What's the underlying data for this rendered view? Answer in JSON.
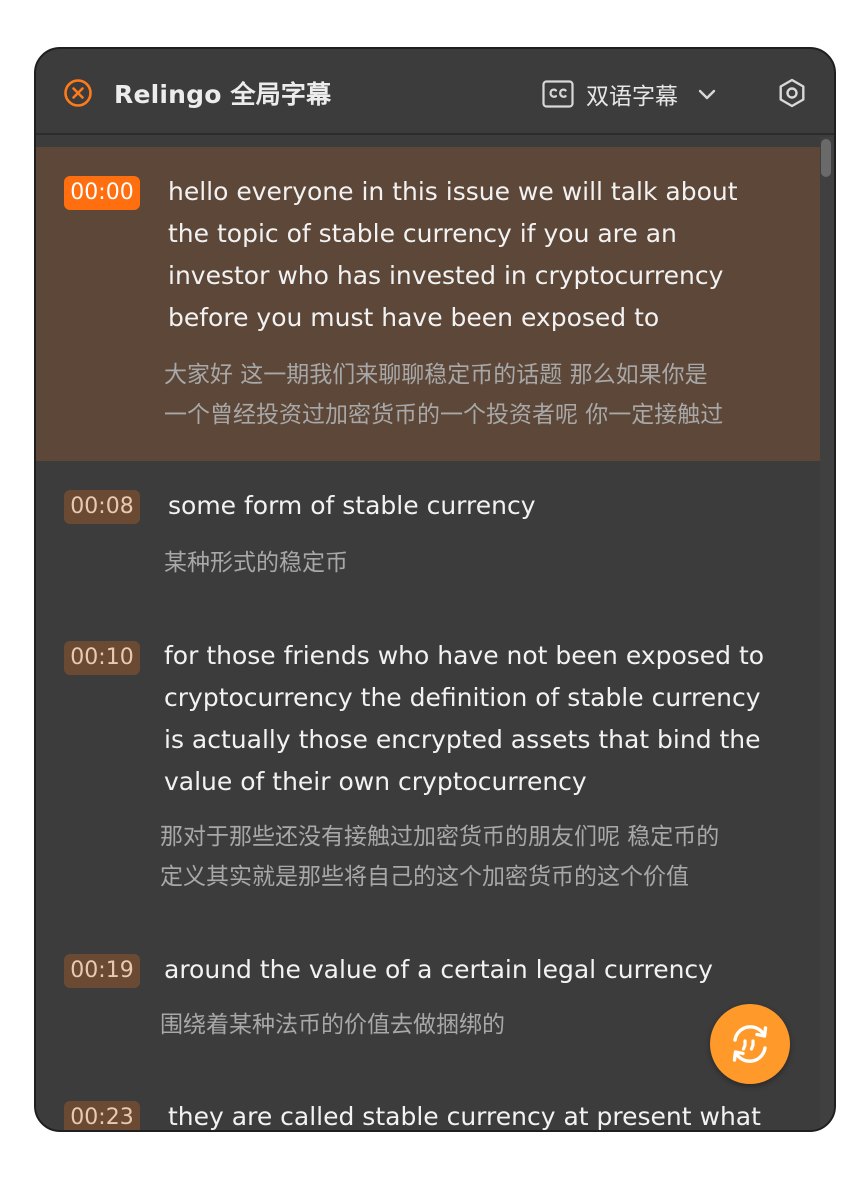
{
  "header": {
    "title": "Relingo 全局字幕",
    "mode_label": "双语字幕",
    "close_icon": "close-circle-icon",
    "cc_icon": "cc-icon",
    "settings_icon": "hexagon-gear-icon",
    "accent": "#ff7a1a"
  },
  "subtitles": [
    {
      "time": "00:00",
      "active": true,
      "en_lines": [
        "hello everyone in this issue we will talk about",
        "the topic of stable currency if you are an",
        "investor who has invested in cryptocurrency",
        "before you must have been exposed to"
      ],
      "zh_lines": [
        "大家好 这一期我们来聊聊稳定币的话题 那么如果你是",
        "一个曾经投资过加密货币的一个投资者呢 你一定接触过"
      ]
    },
    {
      "time": "00:08",
      "active": false,
      "en_lines": [
        "some form of stable currency"
      ],
      "zh_lines": [
        "某种形式的稳定币"
      ]
    },
    {
      "time": "00:10",
      "active": false,
      "en_lines": [
        "for those friends who have not been exposed to",
        "cryptocurrency the definition of stable currency",
        "is actually those encrypted assets that bind the",
        "value of their own cryptocurrency"
      ],
      "zh_lines": [
        "那对于那些还没有接触过加密货币的朋友们呢 稳定币的",
        "定义其实就是那些将自己的这个加密货币的这个价值"
      ]
    },
    {
      "time": "00:19",
      "active": false,
      "en_lines": [
        "around the value of a certain legal currency"
      ],
      "zh_lines": [
        "围绕着某种法币的价值去做捆绑的"
      ]
    },
    {
      "time": "00:23",
      "active": false,
      "en_lines": [
        "they are called stable currency at present what"
      ],
      "zh_lines": []
    }
  ],
  "fab": {
    "icon": "sync-quote-icon",
    "color": "#ff9a2a"
  }
}
